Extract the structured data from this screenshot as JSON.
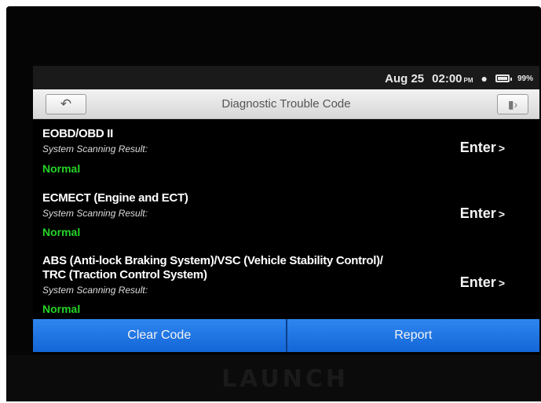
{
  "status_bar": {
    "date": "Aug 25",
    "time": "02:00",
    "time_suffix": "PM",
    "battery": "99%"
  },
  "header": {
    "title": "Diagnostic Trouble Code",
    "back_icon": "back-arrow-icon",
    "exit_icon": "exit-icon"
  },
  "systems": [
    {
      "name_line1": "EOBD/OBD II",
      "name_line2": "",
      "result_label": "System Scanning Result:",
      "status": "Normal",
      "action": "Enter",
      "action_arrow": ">"
    },
    {
      "name_line1": "ECMECT (Engine and ECT)",
      "name_line2": "",
      "result_label": "System Scanning Result:",
      "status": "Normal",
      "action": "Enter",
      "action_arrow": ">"
    },
    {
      "name_line1": "ABS (Anti-lock Braking System)/VSC (Vehicle Stability Control)/",
      "name_line2": "TRC (Traction Control System)",
      "result_label": "System Scanning Result:",
      "status": "Normal",
      "action": "Enter",
      "action_arrow": ">"
    }
  ],
  "footer": {
    "clear_code": "Clear Code",
    "report": "Report"
  },
  "device": {
    "brand": "LAUNCH"
  },
  "colors": {
    "button_blue": "#1e78e6",
    "status_green": "#25d425"
  }
}
